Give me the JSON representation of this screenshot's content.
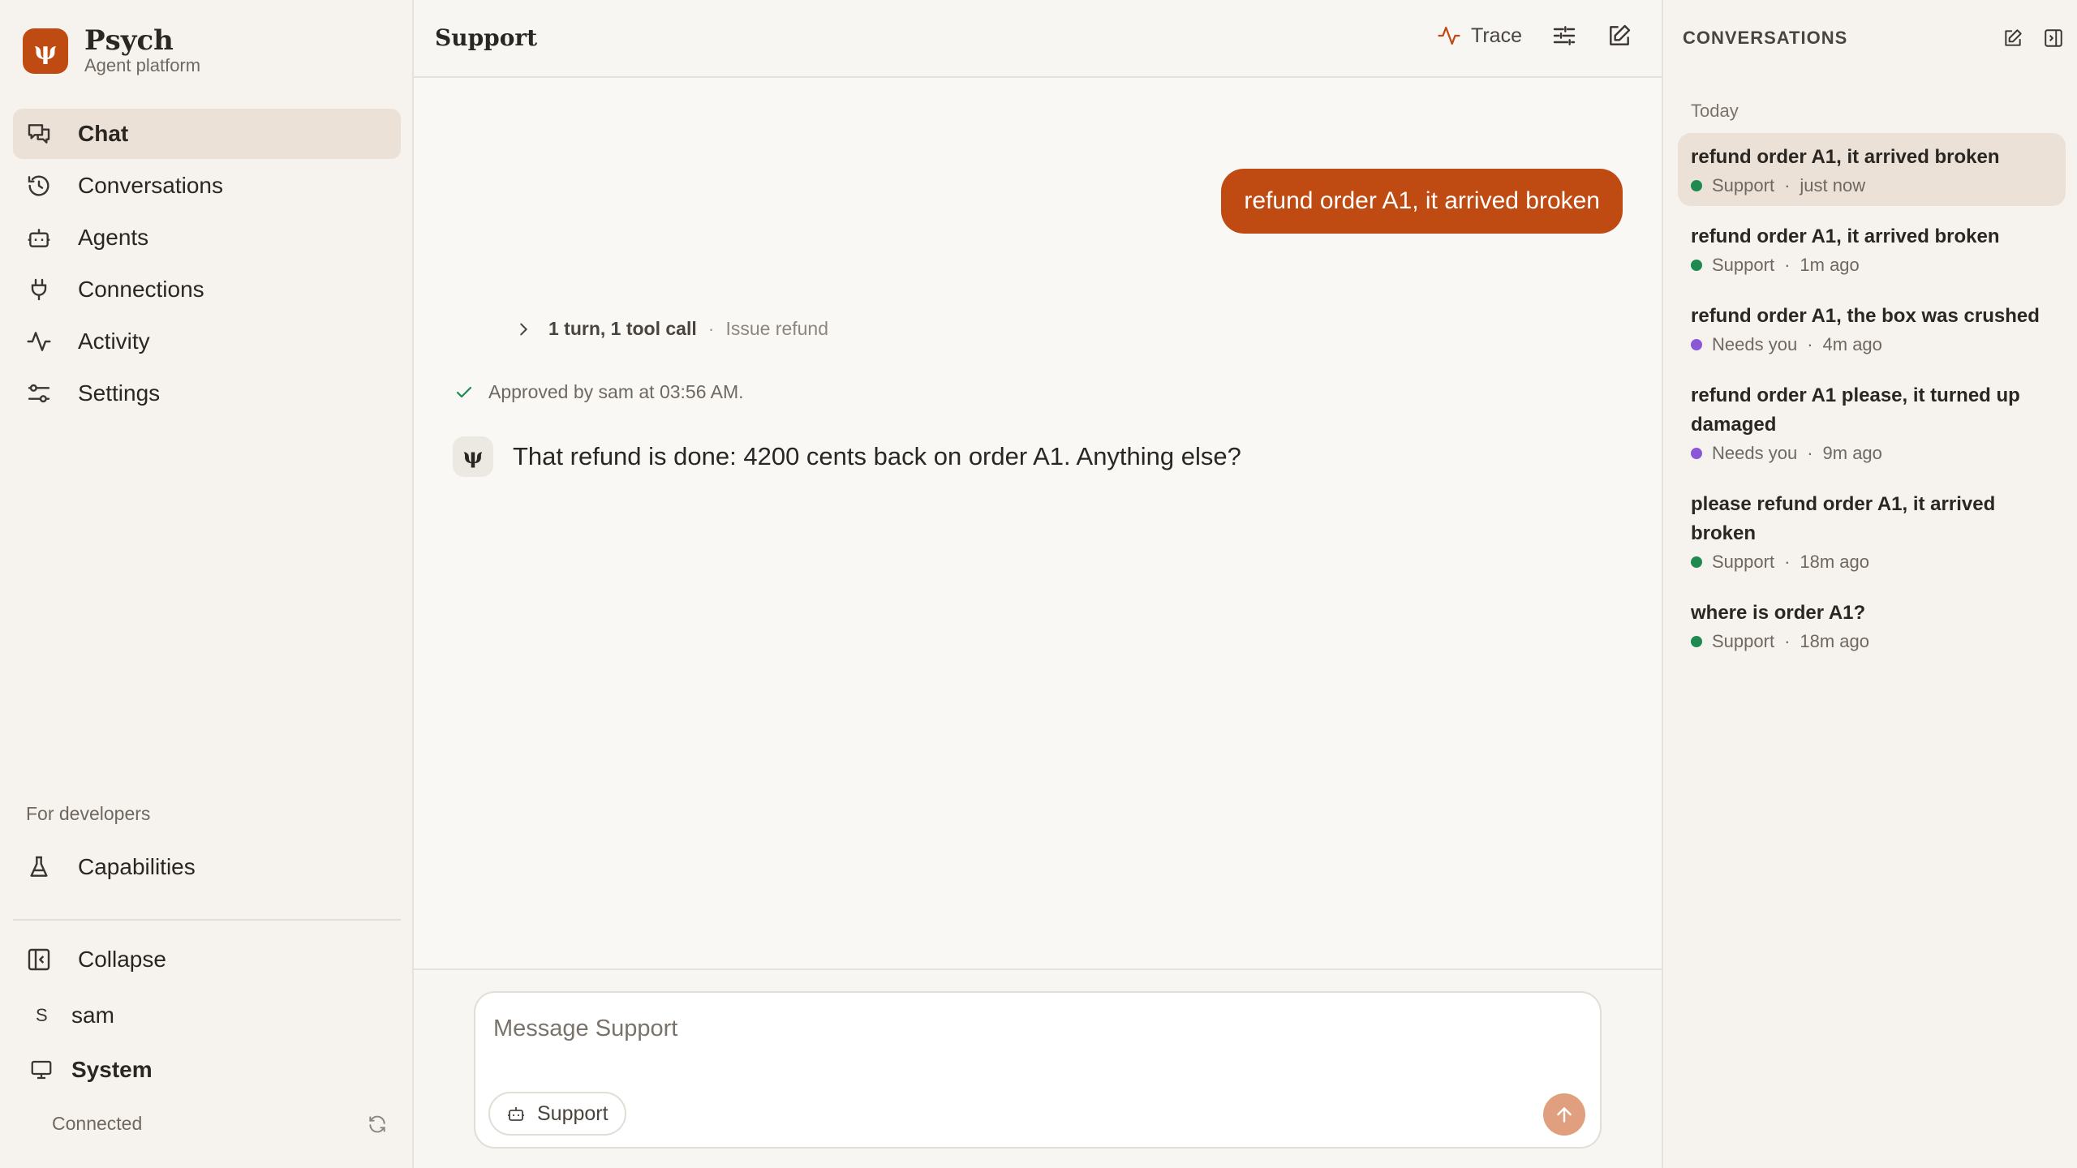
{
  "brand": {
    "name": "Psych",
    "subtitle": "Agent platform",
    "logo_glyph": "ψ"
  },
  "nav": {
    "items": [
      {
        "label": "Chat",
        "icon": "chat-icon",
        "active": true
      },
      {
        "label": "Conversations",
        "icon": "history-icon"
      },
      {
        "label": "Agents",
        "icon": "bot-icon"
      },
      {
        "label": "Connections",
        "icon": "plug-icon"
      },
      {
        "label": "Activity",
        "icon": "activity-icon"
      },
      {
        "label": "Settings",
        "icon": "settings-sliders-icon"
      }
    ],
    "dev_heading": "For developers",
    "capabilities": "Capabilities",
    "collapse": "Collapse",
    "user_initial": "S",
    "user_name": "sam",
    "system": "System",
    "connection_status": "Connected"
  },
  "main": {
    "title": "Support",
    "trace_label": "Trace",
    "user_message": "refund order A1, it arrived broken",
    "turn_summary": "1 turn, 1 tool call",
    "turn_separator": "·",
    "turn_tool": "Issue refund",
    "approval": "Approved by sam at 03:56 AM.",
    "agent_glyph": "ψ",
    "agent_message": "That refund is done: 4200 cents back on order A1. Anything else?",
    "composer": {
      "placeholder": "Message Support",
      "agent_chip": "Support"
    }
  },
  "conversations": {
    "title": "CONVERSATIONS",
    "group_label": "Today",
    "items": [
      {
        "title": "refund order A1, it arrived broken",
        "agent": "Support",
        "time": "just now",
        "status_color": "#1e8a4f",
        "active": true
      },
      {
        "title": "refund order A1, it arrived broken",
        "agent": "Support",
        "time": "1m ago",
        "status_color": "#1e8a4f"
      },
      {
        "title": "refund order A1, the box was crushed",
        "agent": "Needs you",
        "time": "4m ago",
        "status_color": "#8a57d6"
      },
      {
        "title": "refund order A1 please, it turned up damaged",
        "agent": "Needs you",
        "time": "9m ago",
        "status_color": "#8a57d6"
      },
      {
        "title": "please refund order A1, it arrived broken",
        "agent": "Support",
        "time": "18m ago",
        "status_color": "#1e8a4f"
      },
      {
        "title": "where is order A1?",
        "agent": "Support",
        "time": "18m ago",
        "status_color": "#1e8a4f"
      }
    ],
    "meta_separator": "·"
  },
  "colors": {
    "accent": "#bf4b13",
    "active_bg": "#ece1d7",
    "send_disabled": "#e0a07f",
    "approved": "#1e8a4f"
  }
}
